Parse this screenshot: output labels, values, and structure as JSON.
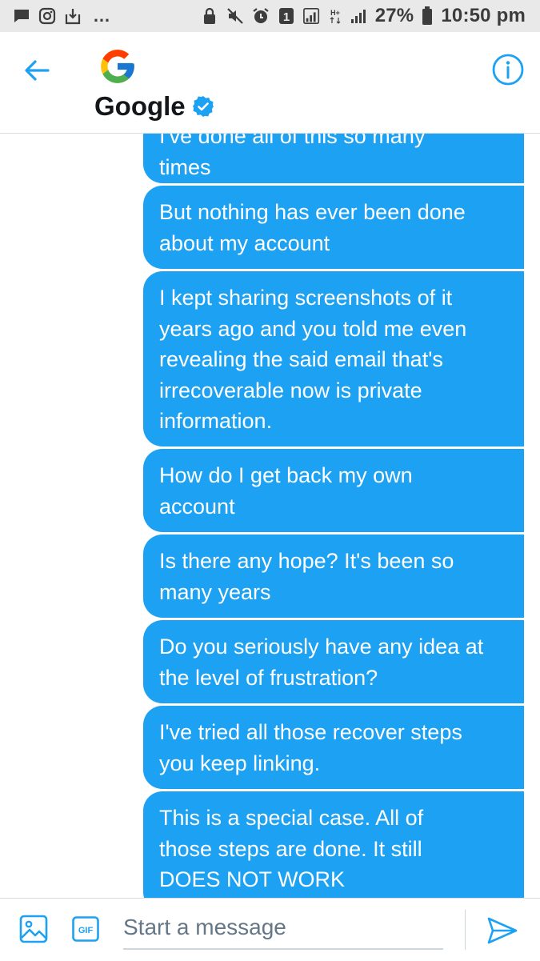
{
  "status_bar": {
    "battery": "27%",
    "time": "10:50 pm",
    "sim_slot": "1",
    "network": "H+",
    "left_icons": [
      "chat-notification-icon",
      "instagram-icon",
      "download-icon"
    ],
    "overflow": "…",
    "right_icons": [
      "lock-icon",
      "mute-icon",
      "alarm-icon",
      "sim-slot-icon",
      "signal-icon",
      "signal-icon-2",
      "battery-icon"
    ]
  },
  "header": {
    "contact_name": "Google",
    "verified": true,
    "icons": {
      "back": "arrow-left-icon",
      "avatar": "google-logo",
      "info": "info-icon",
      "badge": "verified-badge-icon"
    }
  },
  "messages": [
    {
      "lines": [
        "I've done all of this so many",
        "times"
      ]
    },
    {
      "lines": [
        "But nothing has ever been done",
        "about my account"
      ]
    },
    {
      "lines": [
        "I kept sharing screenshots of it",
        "years ago and you told me even",
        "revealing the said email that's",
        "irrecoverable now is private",
        "information."
      ]
    },
    {
      "lines": [
        "How do I get back my own",
        "account"
      ]
    },
    {
      "lines": [
        "Is there any hope? It's been so",
        "many years"
      ]
    },
    {
      "lines": [
        "Do you seriously have any idea at",
        "the level of frustration?"
      ]
    },
    {
      "lines": [
        "I've tried all those recover steps",
        "you keep linking."
      ]
    },
    {
      "lines": [
        "This is a special case. All of",
        "those steps are done. It still",
        "DOES NOT WORK"
      ]
    }
  ],
  "composer": {
    "placeholder": "Start a message",
    "gif_label": "GIF",
    "icons": {
      "media": "image-icon",
      "gif": "gif-icon",
      "send": "send-icon"
    }
  },
  "colors": {
    "accent": "#1da1f2",
    "bubble_text": "#ffffff",
    "status_bar_bg": "#e9e9ea",
    "placeholder": "#657786"
  }
}
